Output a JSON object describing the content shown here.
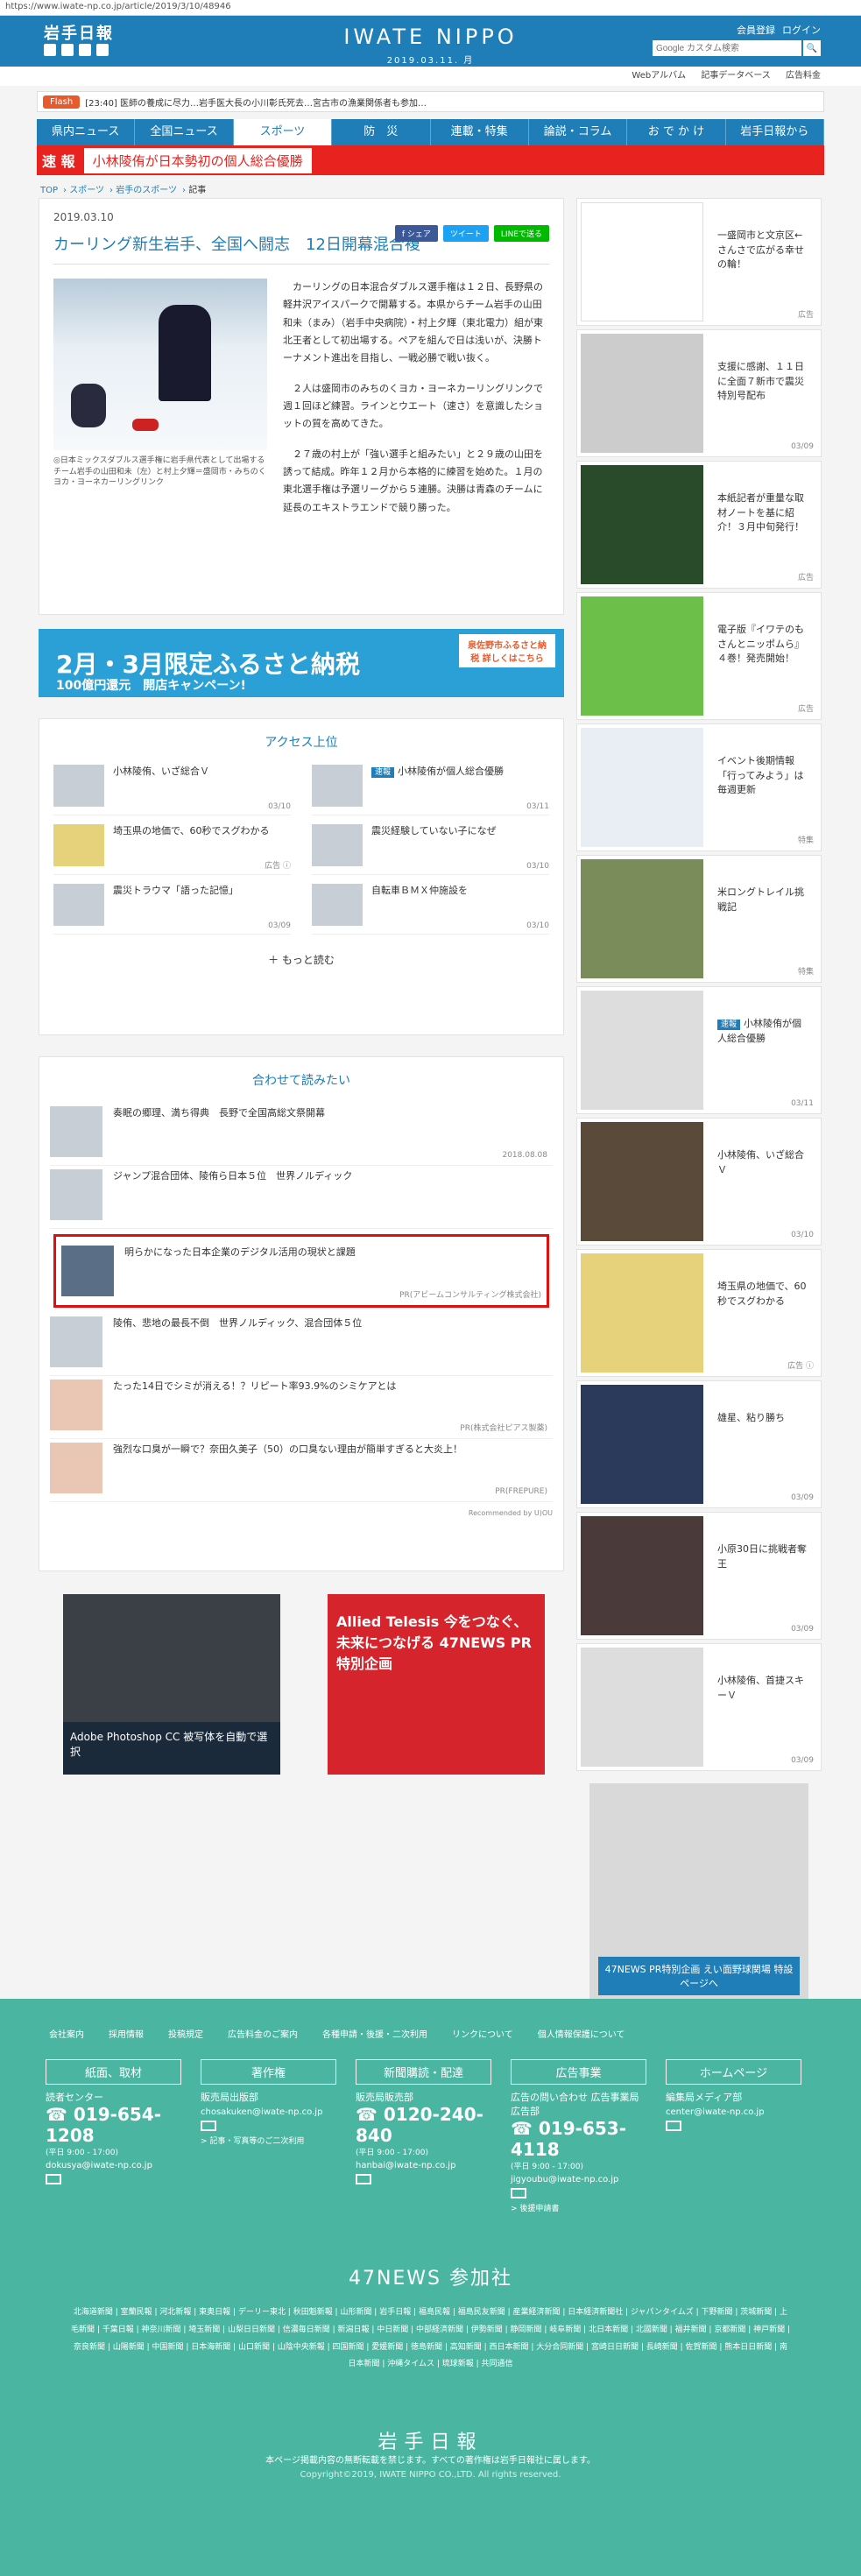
{
  "url": "https://www.iwate-np.co.jp/article/2019/3/10/48946",
  "header": {
    "logo": "岩手日報",
    "brand": "IWATE NIPPO",
    "date": "2019.03.11. 月",
    "member_register": "会員登録",
    "login": "ログイン",
    "search_placeholder": "Google カスタム検索",
    "search_button": "🔍"
  },
  "util_links": [
    "Webアルバム",
    "記事データベース",
    "広告料金"
  ],
  "flash": {
    "tag": "Flash",
    "text": "[23:40] 医師の養成に尽力…岩手医大長の小川彰氏死去…宮古市の漁業関係者も参加…"
  },
  "nav": [
    "県内ニュース",
    "全国ニュース",
    "スポーツ",
    "防　災",
    "連載・特集",
    "論説・コラム",
    "お で か け",
    "岩手日報から"
  ],
  "nav_active": "スポーツ",
  "breaking": {
    "tag": "速 報",
    "message": "小林陵侑が日本勢初の個人総合優勝"
  },
  "breadcrumb": [
    "TOP",
    "スポーツ",
    "岩手のスポーツ",
    "記事"
  ],
  "article": {
    "date": "2019.03.10",
    "share": [
      "f シェア",
      "ツイート",
      "LINEで送る"
    ],
    "title": "カーリング新生岩手、全国へ闘志　12日開幕混合複",
    "caption": "◎日本ミックスダブルス選手権に岩手県代表として出場するチーム岩手の山田和未（左）と村上夕輝＝盛岡市・みちのくヨカ・ヨーネカーリングリンク",
    "paragraphs": [
      "カーリングの日本混合ダブルス選手権は１２日、長野県の軽井沢アイスパークで開幕する。本県からチーム岩手の山田和未（まみ）（岩手中央病院）・村上夕輝（東北電力）組が東北王者として初出場する。ペアを組んで日は浅いが、決勝トーナメント進出を目指し、一戦必勝で戦い抜く。",
      "２人は盛岡市のみちのくヨカ・ヨーネカーリングリンクで週１回ほど練習。ラインとウエート（速さ）を意識したショットの質を高めてきた。",
      "２７歳の村上が「強い選手と組みたい」と２９歳の山田を誘って結成。昨年１２月から本格的に練習を始めた。１月の東北選手権は予選リーグから５連勝。決勝は青森のチームに延長のエキストラエンドで競り勝った。"
    ]
  },
  "banner": {
    "main": "2月・3月限定ふるさと納税",
    "sub": "100億円還元　開店キャンペーン!",
    "badge": "泉佐野市ふるさと納税 詳しくはこちら"
  },
  "access": {
    "title": "アクセス上位",
    "items": [
      {
        "title": "小林陵侑、いざ総合Ｖ",
        "date": "03/10",
        "badge": ""
      },
      {
        "title": "小林陵侑が個人総合優勝",
        "date": "03/11",
        "badge": "速報"
      },
      {
        "title": "埼玉県の地価で、60秒でスグわかる",
        "date": "広告 ⓘ",
        "badge": ""
      },
      {
        "title": "震災経験していない子になぜ",
        "date": "03/10",
        "badge": ""
      },
      {
        "title": "震災トラウマ「語った記憶」",
        "date": "03/09",
        "badge": ""
      },
      {
        "title": "自転車ＢＭＸ仲施設を",
        "date": "03/10",
        "badge": ""
      }
    ],
    "more": "＋ もっと読む"
  },
  "recommend": {
    "title": "合わせて読みたい",
    "items": [
      {
        "title": "奏眠の郷理、満ち得典　長野で全国高総文祭開幕",
        "date": "2018.08.08",
        "highlight": false
      },
      {
        "title": "ジャンプ混合団体、陵侑ら日本５位　世界ノルディック",
        "date": "",
        "highlight": false
      },
      {
        "title": "明らかになった日本企業のデジタル活用の現状と課題",
        "date": "PR(アビームコンサルティング株式会社)",
        "highlight": true
      },
      {
        "title": "陵侑、悲地の最長不倒　世界ノルディック、混合団体５位",
        "date": "",
        "highlight": false
      },
      {
        "title": "たった14日でシミが消える！？リピート率93.9%のシミケアとは",
        "date": "PR(株式会社ピアス製薬)",
        "highlight": false
      },
      {
        "title": "強烈な口臭が一瞬で？奈田久美子（50）の口臭ない理由が簡単すぎると大炎上！",
        "date": "PR(FREPURE)",
        "highlight": false
      }
    ],
    "powered": "Recommended by U)OU"
  },
  "ads": [
    {
      "label": "Adobe Photoshop CC 被写体を自動で選択"
    },
    {
      "label": "Allied Telesis 今をつなぐ、未来につなげる 47NEWS PR特別企画"
    }
  ],
  "side": [
    {
      "title": "一盛岡市と文京区←さんさで広がる幸せの輪！",
      "date": "広告"
    },
    {
      "title": "支援に感謝、１１日に全面７新市で震災特別号配布",
      "date": "03/09"
    },
    {
      "title": "本紙記者が重量な取材ノートを基に紹介！３月中旬発行！",
      "date": "広告"
    },
    {
      "title": "電子版『イワテのもさんとニッポムら』４巻！発売開始！",
      "date": "広告"
    },
    {
      "title": "イベント後期情報「行ってみよう」は毎週更新",
      "date": "特集"
    },
    {
      "title": "米ロングトレイル挑戦記",
      "date": "特集"
    },
    {
      "title": "小林陵侑が個人総合優勝",
      "date": "03/11",
      "badge": "速報"
    },
    {
      "title": "小林陵侑、いざ総合Ｖ",
      "date": "03/10"
    },
    {
      "title": "埼玉県の地価で、60秒でスグわかる",
      "date": "広告 ⓘ"
    },
    {
      "title": "雄星、粘り勝ち",
      "date": "03/09"
    },
    {
      "title": "小原30日に挑戦者奪王",
      "date": "03/09"
    },
    {
      "title": "小林陵侑、首捷スキーＶ",
      "date": "03/09"
    }
  ],
  "side_ad": "47NEWS PR特別企画 えい面野球関場 特設ページへ",
  "footer": {
    "links": [
      "会社案内",
      "採用情報",
      "投稿規定",
      "広告料金のご案内",
      "各種申請・後援・二次利用",
      "リンクについて",
      "個人情報保護について"
    ],
    "cols": [
      {
        "head": "紙面、取材",
        "label": "読者センター",
        "tel": "019-654-1208",
        "hours": "(平日 9:00 - 17:00)",
        "mail": "dokusya@iwate-np.co.jp"
      },
      {
        "head": "著作権",
        "label": "販売局出版部",
        "tel": "",
        "hours": "",
        "mail": "chosakuken@iwate-np.co.jp",
        "note": "> 記事・写真等のご二次利用"
      },
      {
        "head": "新聞購読・配達",
        "label": "販売局販売部",
        "tel": "0120-240-840",
        "hours": "(平日 9:00 - 17:00)",
        "mail": "hanbai@iwate-np.co.jp"
      },
      {
        "head": "広告事業",
        "label": "広告の問い合わせ 広告事業局広告部",
        "tel": "019-653-4118",
        "hours": "(平日 9:00 - 17:00)",
        "mail": "jigyoubu@iwate-np.co.jp",
        "note": "> 後援申請書"
      },
      {
        "head": "ホームページ",
        "label": "編集局メディア部",
        "tel": "",
        "hours": "",
        "mail": "center@iwate-np.co.jp"
      }
    ],
    "news47": "47NEWS 参加社",
    "papers": "北海道新聞 | 室蘭民報 | 河北新報 | 東奥日報 | デーリー東北 | 秋田魁新報 | 山形新聞 | 岩手日報 | 福島民報 | 福島民友新聞 | 産業経済新聞 | 日本経済新聞社 | ジャパンタイムズ | 下野新聞 | 茨城新聞 | 上毛新聞 | 千葉日報 | 神奈川新聞 | 埼玉新聞 | 山梨日日新聞 | 信濃毎日新聞 | 新潟日報 | 中日新聞 | 中部経済新聞 | 伊勢新聞 | 静岡新聞 | 岐阜新聞 | 北日本新聞 | 北國新聞 | 福井新聞 | 京都新聞 | 神戸新聞 | 奈良新聞 | 山陽新聞 | 中国新聞 | 日本海新聞 | 山口新聞 | 山陰中央新報 | 四国新聞 | 愛媛新聞 | 徳島新聞 | 高知新聞 | 西日本新聞 | 大分合同新聞 | 宮崎日日新聞 | 長崎新聞 | 佐賀新聞 | 熊本日日新聞 | 南日本新聞 | 沖縄タイムス | 琉球新報 | 共同通信",
    "logo": "岩手日報",
    "notice": "本ページ掲載内容の無断転載を禁じます。すべての著作権は岩手日報社に属します。",
    "copyright": "Copyright©2019, IWATE NIPPO CO.,LTD. All rights reserved."
  }
}
